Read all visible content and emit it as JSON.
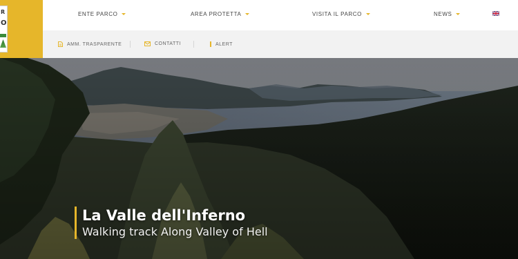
{
  "nav": {
    "items": [
      {
        "label": "ENTE PARCO"
      },
      {
        "label": "AREA PROTETTA"
      },
      {
        "label": "VISITA IL PARCO"
      },
      {
        "label": "NEWS"
      }
    ],
    "language_icon": "uk-flag-icon"
  },
  "utility": {
    "items": [
      {
        "label": "AMM. TRASPARENTE",
        "icon": "document-icon"
      },
      {
        "label": "CONTATTI",
        "icon": "envelope-icon"
      },
      {
        "label": "ALERT",
        "icon": "alert-bar-icon"
      }
    ]
  },
  "hero": {
    "title": "La Valle dell'Inferno",
    "subtitle": "Walking track Along Valley of Hell"
  },
  "colors": {
    "accent": "#e6b62a",
    "nav_bg": "#ffffff",
    "util_bg": "#f2f2f2"
  }
}
